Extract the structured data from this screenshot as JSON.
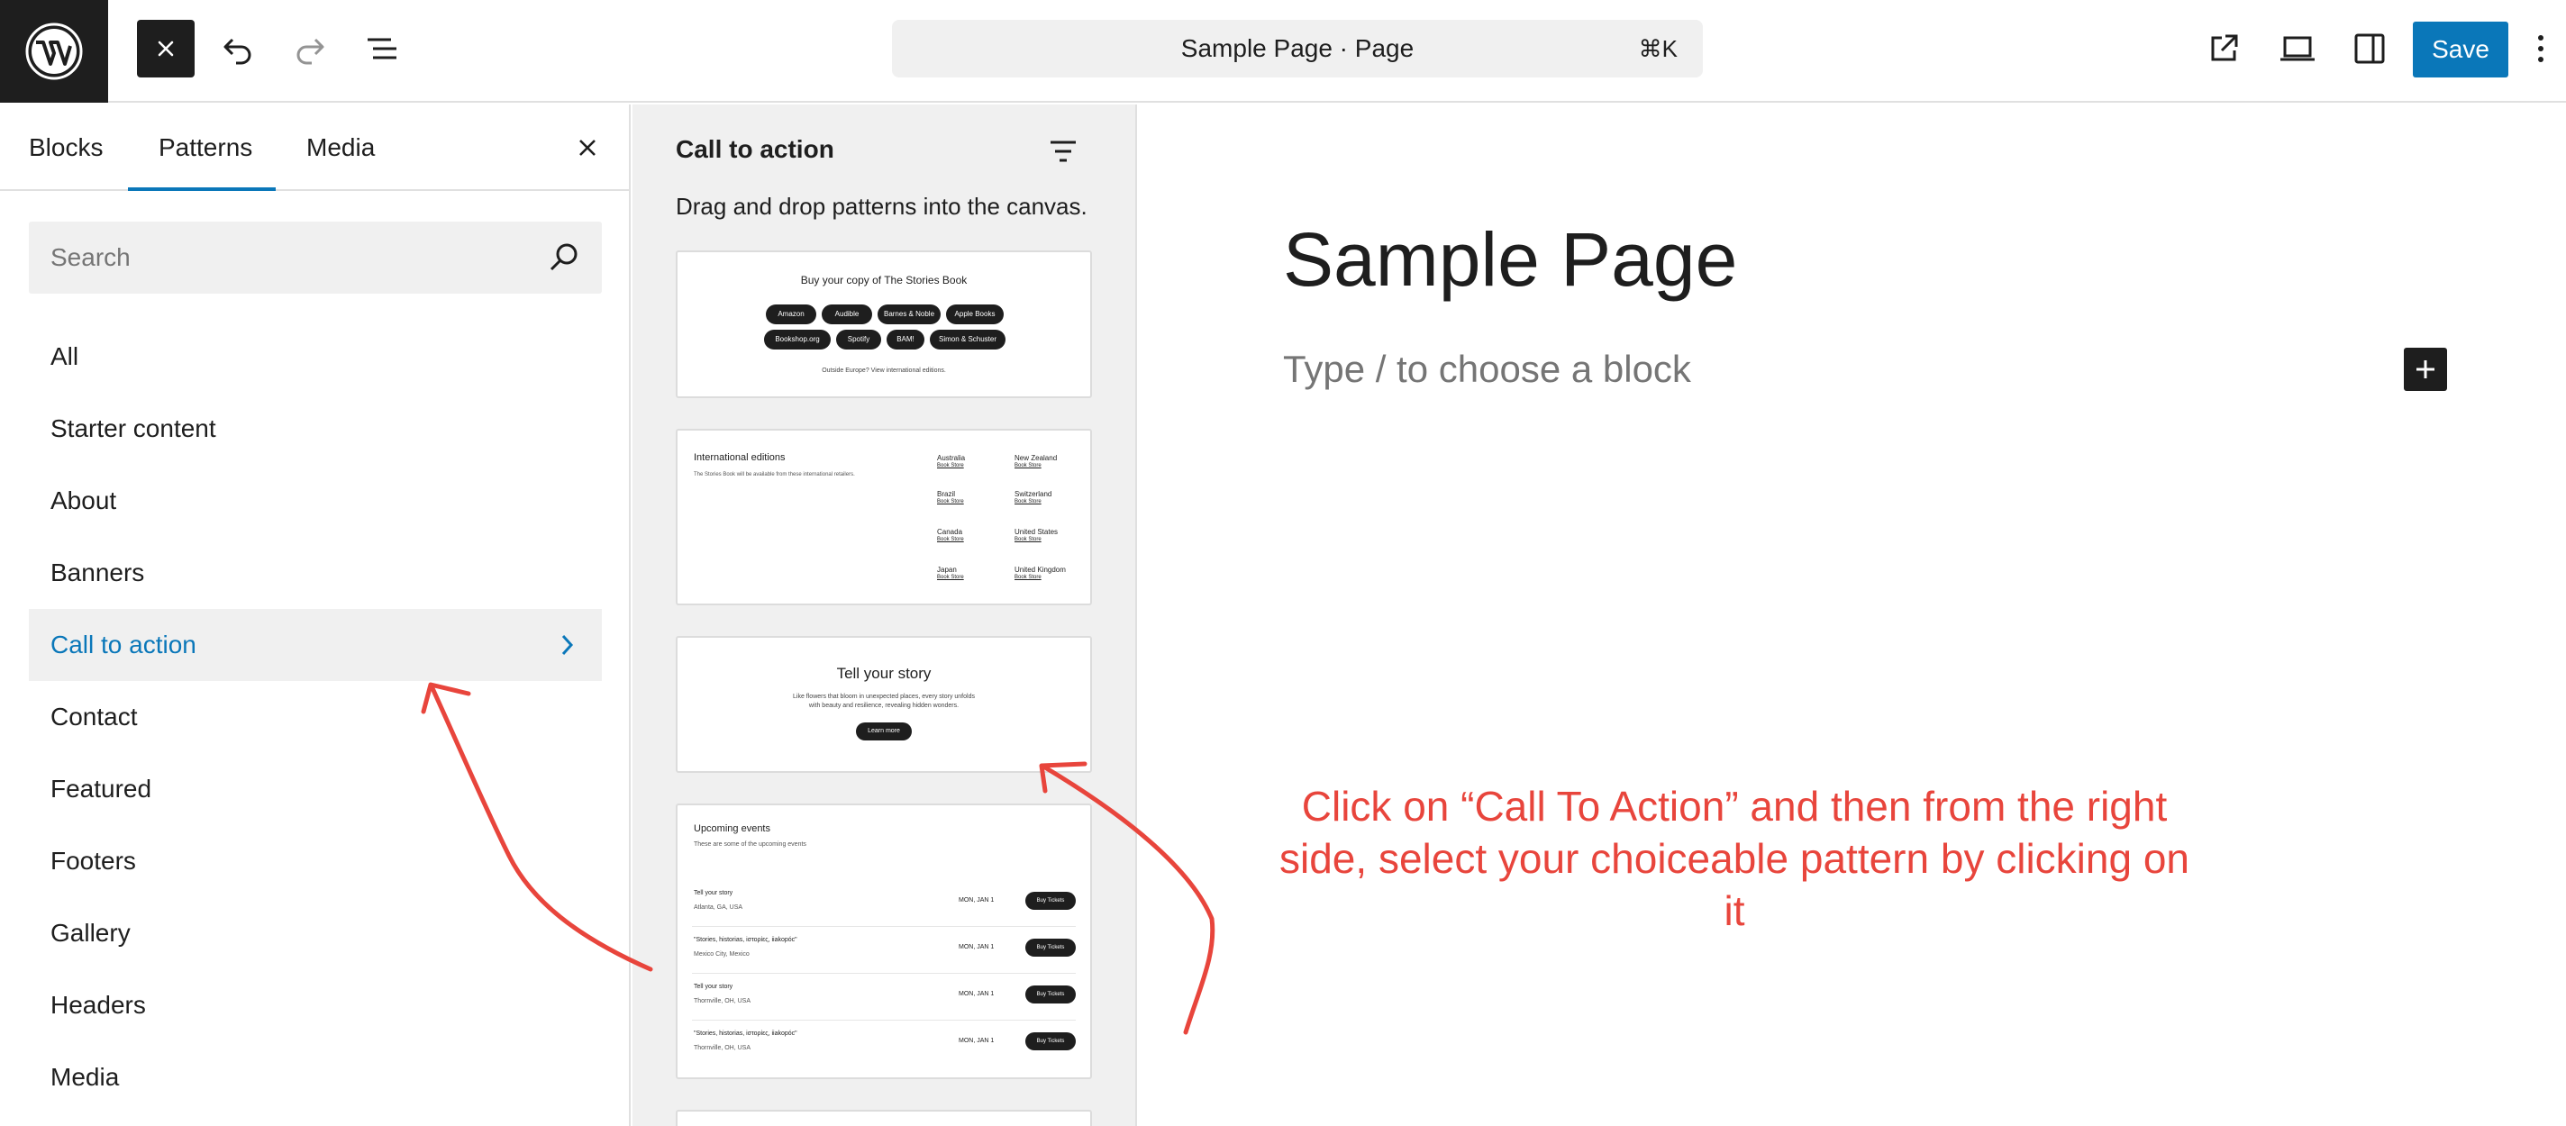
{
  "topbar": {
    "close_icon": "close-icon",
    "undo_icon": "undo-icon",
    "redo_icon": "redo-icon",
    "document_overview_icon": "list-view-icon",
    "command_title": "Sample Page · Page",
    "command_shortcut": "⌘K",
    "view_icon": "external-link-icon",
    "device_icon": "laptop-icon",
    "settings_icon": "sidebar-icon",
    "save_label": "Save",
    "more_icon": "more-vertical-icon",
    "accent": "#0a77b9"
  },
  "inserter": {
    "tabs": [
      {
        "label": "Blocks"
      },
      {
        "label": "Patterns"
      },
      {
        "label": "Media"
      }
    ],
    "active_tab": "Patterns",
    "search_placeholder": "Search",
    "categories": [
      {
        "label": "All"
      },
      {
        "label": "Starter content"
      },
      {
        "label": "About"
      },
      {
        "label": "Banners"
      },
      {
        "label": "Call to action"
      },
      {
        "label": "Contact"
      },
      {
        "label": "Featured"
      },
      {
        "label": "Footers"
      },
      {
        "label": "Gallery"
      },
      {
        "label": "Headers"
      },
      {
        "label": "Media"
      }
    ],
    "active_category": "Call to action"
  },
  "patterns_panel": {
    "title": "Call to action",
    "description": "Drag and drop patterns into the canvas.",
    "card1": {
      "heading": "Buy your copy of The Stories Book",
      "buttons": [
        "Amazon",
        "Audible",
        "Barnes & Noble",
        "Apple Books",
        "Bookshop.org",
        "Spotify",
        "BAM!",
        "Simon & Schuster"
      ],
      "footnote": "Outside Europe? View international editions."
    },
    "card2": {
      "heading": "International editions",
      "subtext": "The Stories Book will be available from these international retailers.",
      "link_label": "Book Store",
      "countries": [
        "Australia",
        "New Zealand",
        "Brazil",
        "Switzerland",
        "Canada",
        "United States",
        "Japan",
        "United Kingdom"
      ]
    },
    "card3": {
      "heading": "Tell your story",
      "body_line1": "Like flowers that bloom in unexpected places, every story unfolds",
      "body_line2": "with beauty and resilience, revealing hidden wonders.",
      "button": "Learn more"
    },
    "card4": {
      "heading": "Upcoming events",
      "subtext": "These are some of the upcoming events",
      "events": [
        {
          "title": "Tell your story",
          "location": "Atlanta, GA, USA",
          "date": "MON, JAN 1",
          "button": "Buy Tickets"
        },
        {
          "title": "\"Stories, historias, iστορίες, iiakopóc\"",
          "location": "Mexico City, Mexico",
          "date": "MON, JAN 1",
          "button": "Buy Tickets"
        },
        {
          "title": "Tell your story",
          "location": "Thornville, OH, USA",
          "date": "MON, JAN 1",
          "button": "Buy Tickets"
        },
        {
          "title": "\"Stories, historias, iστορίες, iiakopóc\"",
          "location": "Thornville, OH, USA",
          "date": "MON, JAN 1",
          "button": "Buy Tickets"
        }
      ]
    }
  },
  "canvas": {
    "page_title": "Sample Page",
    "block_placeholder": "Type / to choose a block",
    "add_block_icon": "plus-icon"
  },
  "annotation": {
    "text": "Click on “Call To Action” and then from the right side, select your choiceable pattern by clicking on it",
    "color": "#e8453c"
  }
}
